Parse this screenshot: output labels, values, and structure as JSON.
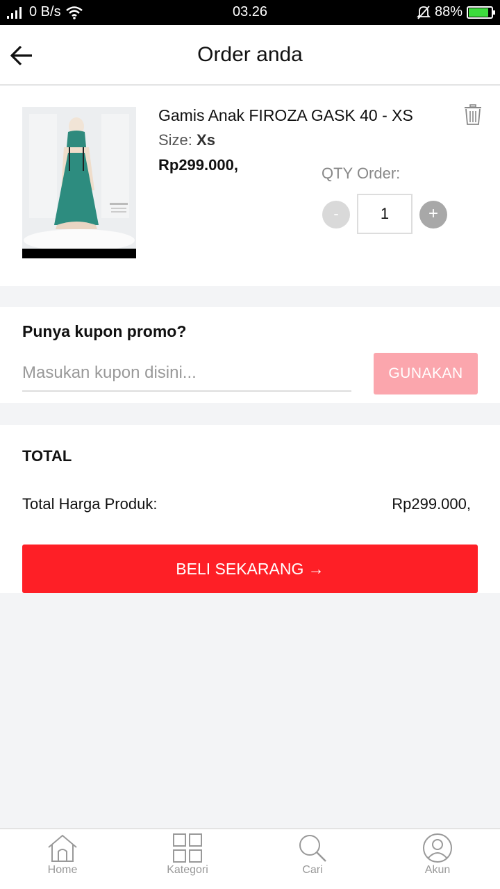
{
  "status_bar": {
    "net_speed": "0 B/s",
    "time": "03.26",
    "battery": "88%"
  },
  "header": {
    "title": "Order anda"
  },
  "product": {
    "name": "Gamis Anak FIROZA GASK 40 - XS",
    "size_label": "Size:",
    "size_value": "Xs",
    "price": "Rp299.000,",
    "qty_label": "QTY Order:",
    "qty_minus": "-",
    "qty_value": "1",
    "qty_plus": "+"
  },
  "coupon": {
    "title": "Punya kupon promo?",
    "placeholder": "Masukan kupon disini...",
    "button_label": "GUNAKAN"
  },
  "total": {
    "title": "TOTAL",
    "label": "Total Harga Produk:",
    "value": "Rp299.000,",
    "buy_label": "BELI SEKARANG →"
  },
  "bottom_nav": {
    "items": [
      {
        "label": "Home",
        "icon": "home-icon"
      },
      {
        "label": "Kategori",
        "icon": "grid-icon"
      },
      {
        "label": "Cari",
        "icon": "search-icon"
      },
      {
        "label": "Akun",
        "icon": "user-icon"
      }
    ]
  },
  "colors": {
    "primary": "#fe1f26",
    "coupon_button": "#fba6ad",
    "background": "#f3f4f6"
  }
}
